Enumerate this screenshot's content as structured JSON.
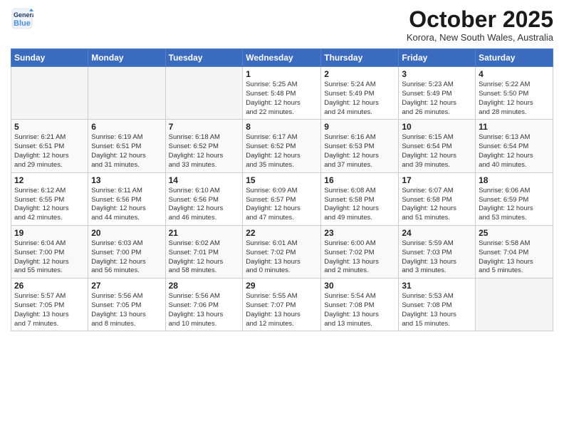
{
  "header": {
    "logo_line1": "General",
    "logo_line2": "Blue",
    "month": "October 2025",
    "location": "Korora, New South Wales, Australia"
  },
  "weekdays": [
    "Sunday",
    "Monday",
    "Tuesday",
    "Wednesday",
    "Thursday",
    "Friday",
    "Saturday"
  ],
  "weeks": [
    [
      {
        "day": "",
        "info": ""
      },
      {
        "day": "",
        "info": ""
      },
      {
        "day": "",
        "info": ""
      },
      {
        "day": "1",
        "info": "Sunrise: 5:25 AM\nSunset: 5:48 PM\nDaylight: 12 hours\nand 22 minutes."
      },
      {
        "day": "2",
        "info": "Sunrise: 5:24 AM\nSunset: 5:49 PM\nDaylight: 12 hours\nand 24 minutes."
      },
      {
        "day": "3",
        "info": "Sunrise: 5:23 AM\nSunset: 5:49 PM\nDaylight: 12 hours\nand 26 minutes."
      },
      {
        "day": "4",
        "info": "Sunrise: 5:22 AM\nSunset: 5:50 PM\nDaylight: 12 hours\nand 28 minutes."
      }
    ],
    [
      {
        "day": "5",
        "info": "Sunrise: 6:21 AM\nSunset: 6:51 PM\nDaylight: 12 hours\nand 29 minutes."
      },
      {
        "day": "6",
        "info": "Sunrise: 6:19 AM\nSunset: 6:51 PM\nDaylight: 12 hours\nand 31 minutes."
      },
      {
        "day": "7",
        "info": "Sunrise: 6:18 AM\nSunset: 6:52 PM\nDaylight: 12 hours\nand 33 minutes."
      },
      {
        "day": "8",
        "info": "Sunrise: 6:17 AM\nSunset: 6:52 PM\nDaylight: 12 hours\nand 35 minutes."
      },
      {
        "day": "9",
        "info": "Sunrise: 6:16 AM\nSunset: 6:53 PM\nDaylight: 12 hours\nand 37 minutes."
      },
      {
        "day": "10",
        "info": "Sunrise: 6:15 AM\nSunset: 6:54 PM\nDaylight: 12 hours\nand 39 minutes."
      },
      {
        "day": "11",
        "info": "Sunrise: 6:13 AM\nSunset: 6:54 PM\nDaylight: 12 hours\nand 40 minutes."
      }
    ],
    [
      {
        "day": "12",
        "info": "Sunrise: 6:12 AM\nSunset: 6:55 PM\nDaylight: 12 hours\nand 42 minutes."
      },
      {
        "day": "13",
        "info": "Sunrise: 6:11 AM\nSunset: 6:56 PM\nDaylight: 12 hours\nand 44 minutes."
      },
      {
        "day": "14",
        "info": "Sunrise: 6:10 AM\nSunset: 6:56 PM\nDaylight: 12 hours\nand 46 minutes."
      },
      {
        "day": "15",
        "info": "Sunrise: 6:09 AM\nSunset: 6:57 PM\nDaylight: 12 hours\nand 47 minutes."
      },
      {
        "day": "16",
        "info": "Sunrise: 6:08 AM\nSunset: 6:58 PM\nDaylight: 12 hours\nand 49 minutes."
      },
      {
        "day": "17",
        "info": "Sunrise: 6:07 AM\nSunset: 6:58 PM\nDaylight: 12 hours\nand 51 minutes."
      },
      {
        "day": "18",
        "info": "Sunrise: 6:06 AM\nSunset: 6:59 PM\nDaylight: 12 hours\nand 53 minutes."
      }
    ],
    [
      {
        "day": "19",
        "info": "Sunrise: 6:04 AM\nSunset: 7:00 PM\nDaylight: 12 hours\nand 55 minutes."
      },
      {
        "day": "20",
        "info": "Sunrise: 6:03 AM\nSunset: 7:00 PM\nDaylight: 12 hours\nand 56 minutes."
      },
      {
        "day": "21",
        "info": "Sunrise: 6:02 AM\nSunset: 7:01 PM\nDaylight: 12 hours\nand 58 minutes."
      },
      {
        "day": "22",
        "info": "Sunrise: 6:01 AM\nSunset: 7:02 PM\nDaylight: 13 hours\nand 0 minutes."
      },
      {
        "day": "23",
        "info": "Sunrise: 6:00 AM\nSunset: 7:02 PM\nDaylight: 13 hours\nand 2 minutes."
      },
      {
        "day": "24",
        "info": "Sunrise: 5:59 AM\nSunset: 7:03 PM\nDaylight: 13 hours\nand 3 minutes."
      },
      {
        "day": "25",
        "info": "Sunrise: 5:58 AM\nSunset: 7:04 PM\nDaylight: 13 hours\nand 5 minutes."
      }
    ],
    [
      {
        "day": "26",
        "info": "Sunrise: 5:57 AM\nSunset: 7:05 PM\nDaylight: 13 hours\nand 7 minutes."
      },
      {
        "day": "27",
        "info": "Sunrise: 5:56 AM\nSunset: 7:05 PM\nDaylight: 13 hours\nand 8 minutes."
      },
      {
        "day": "28",
        "info": "Sunrise: 5:56 AM\nSunset: 7:06 PM\nDaylight: 13 hours\nand 10 minutes."
      },
      {
        "day": "29",
        "info": "Sunrise: 5:55 AM\nSunset: 7:07 PM\nDaylight: 13 hours\nand 12 minutes."
      },
      {
        "day": "30",
        "info": "Sunrise: 5:54 AM\nSunset: 7:08 PM\nDaylight: 13 hours\nand 13 minutes."
      },
      {
        "day": "31",
        "info": "Sunrise: 5:53 AM\nSunset: 7:08 PM\nDaylight: 13 hours\nand 15 minutes."
      },
      {
        "day": "",
        "info": ""
      }
    ]
  ]
}
